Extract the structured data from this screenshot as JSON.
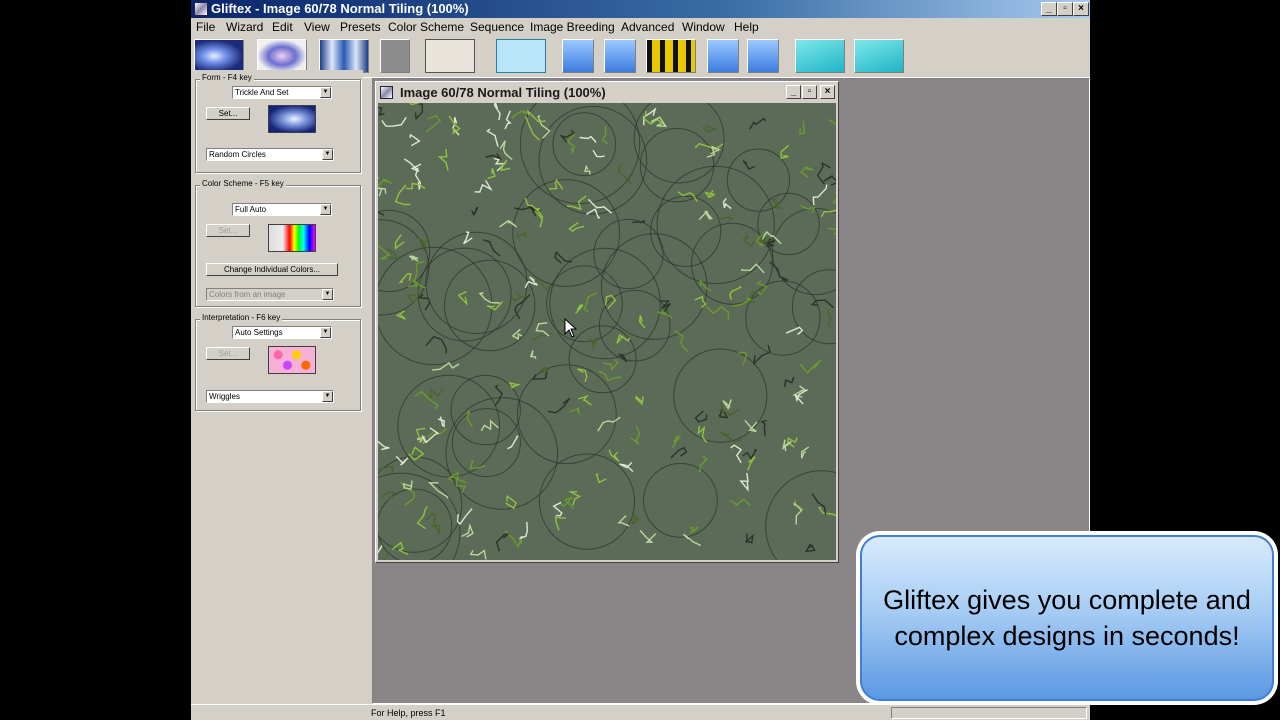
{
  "window": {
    "title": "Gliftex -  Image 60/78 Normal Tiling (100%)",
    "min": "_",
    "max": "▫",
    "close": "×"
  },
  "menu": [
    "File",
    "Wizard",
    "Edit",
    "View",
    "Presets",
    "Color Scheme",
    "Sequence",
    "Image Breeding",
    "Advanced",
    "Window",
    "Help"
  ],
  "form": {
    "label": "Form - F4 key",
    "combo1": "Trickle And Set",
    "set": "Set...",
    "combo2": "Random Circles"
  },
  "color_scheme": {
    "label": "Color Scheme - F5 key",
    "combo1": "Full Auto",
    "set": "Set...",
    "change_btn": "Change Individual Colors...",
    "combo2": "Colors from an image"
  },
  "interpretation": {
    "label": "Interpretation - F6 key",
    "combo1": "Auto Settings",
    "set": "Set...",
    "combo2": "Wriggles"
  },
  "child": {
    "title": "Image 60/78 Normal Tiling (100%)",
    "min": "_",
    "max": "▫",
    "close": "×"
  },
  "status": "For Help, press F1",
  "callout": "Gliftex gives you complete and complex designs in seconds!",
  "colors": {
    "titlebar": "#0a246a",
    "canvas": "#5c6a58",
    "callout": "#7fb3ee"
  },
  "icons": {
    "cursor": "arrow-cursor-icon"
  }
}
